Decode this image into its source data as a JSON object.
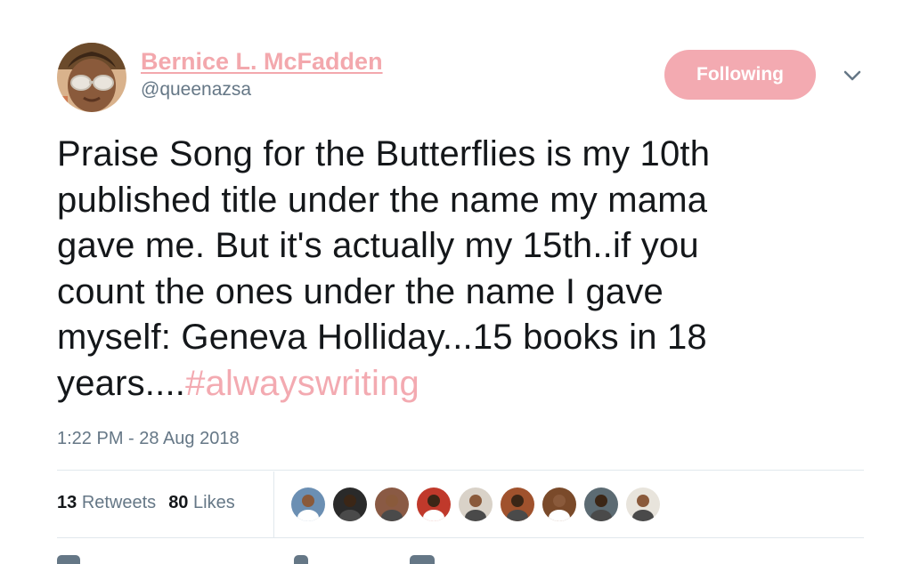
{
  "author": {
    "display_name": "Bernice L. McFadden",
    "handle": "@queenazsa",
    "avatar_icon": "profile-photo"
  },
  "follow_button": {
    "label": "Following",
    "color": "#f3aab1"
  },
  "menu": {
    "icon": "chevron-down-icon"
  },
  "tweet": {
    "lines": [
      "Praise Song for the Butterflies is my 10th",
      "published title under the name my mama",
      "gave me. But it's actually my 15th..if you",
      "count the ones under the name I gave",
      "myself: Geneva Holliday...15 books in 18",
      "years...."
    ],
    "hashtag": "#alwayswriting",
    "hashtag_color": "#f3aab1"
  },
  "timestamp": "1:22 PM - 28 Aug 2018",
  "stats": {
    "retweets_count": "13",
    "retweets_label": "Retweets",
    "likes_count": "80",
    "likes_label": "Likes"
  },
  "likers": [
    {
      "icon": "liker-avatar-1",
      "color": "#6b8fb3"
    },
    {
      "icon": "liker-avatar-2",
      "color": "#2a2a2a"
    },
    {
      "icon": "liker-avatar-3",
      "color": "#8a5a44"
    },
    {
      "icon": "liker-avatar-4",
      "color": "#c0392b"
    },
    {
      "icon": "liker-avatar-5",
      "color": "#d9d2c8"
    },
    {
      "icon": "liker-avatar-6",
      "color": "#a0522d"
    },
    {
      "icon": "liker-avatar-7",
      "color": "#7a4a2a"
    },
    {
      "icon": "liker-avatar-8",
      "color": "#5c6b73"
    },
    {
      "icon": "liker-avatar-9",
      "color": "#e8e4dc"
    }
  ],
  "colors": {
    "accent": "#f3aab1",
    "text": "#14171a",
    "muted": "#657786",
    "divider": "#e1e8ed"
  }
}
